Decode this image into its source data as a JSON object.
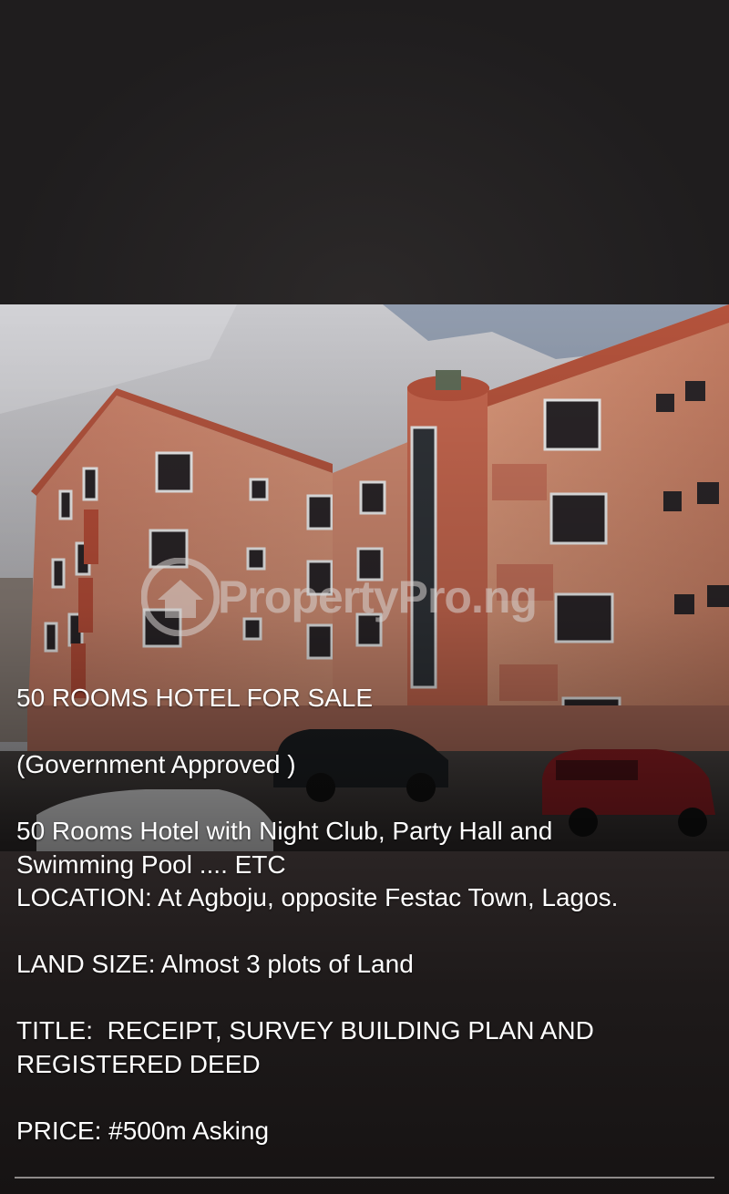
{
  "watermark": {
    "text": "PropertyPro.ng",
    "logo_icon": "house-in-circle-icon"
  },
  "listing": {
    "title": "50 ROOMS HOTEL FOR SALE",
    "approval": "(Government Approved )",
    "description_line1": "50 Rooms Hotel with Night Club, Party Hall and",
    "description_line2": "Swimming Pool .... ETC",
    "location_label": "LOCATION:",
    "location_value": " At Agboju, opposite Festac Town, Lagos.",
    "land_size_label": "LAND SIZE:",
    "land_size_value": " Almost 3 plots of Land",
    "title_label": "TITLE:",
    "title_value_line1": "  RECEIPT, SURVEY BUILDING PLAN AND",
    "title_value_line2": "REGISTERED DEED",
    "price_label": "PRICE:",
    "price_value": " #500m Asking"
  }
}
